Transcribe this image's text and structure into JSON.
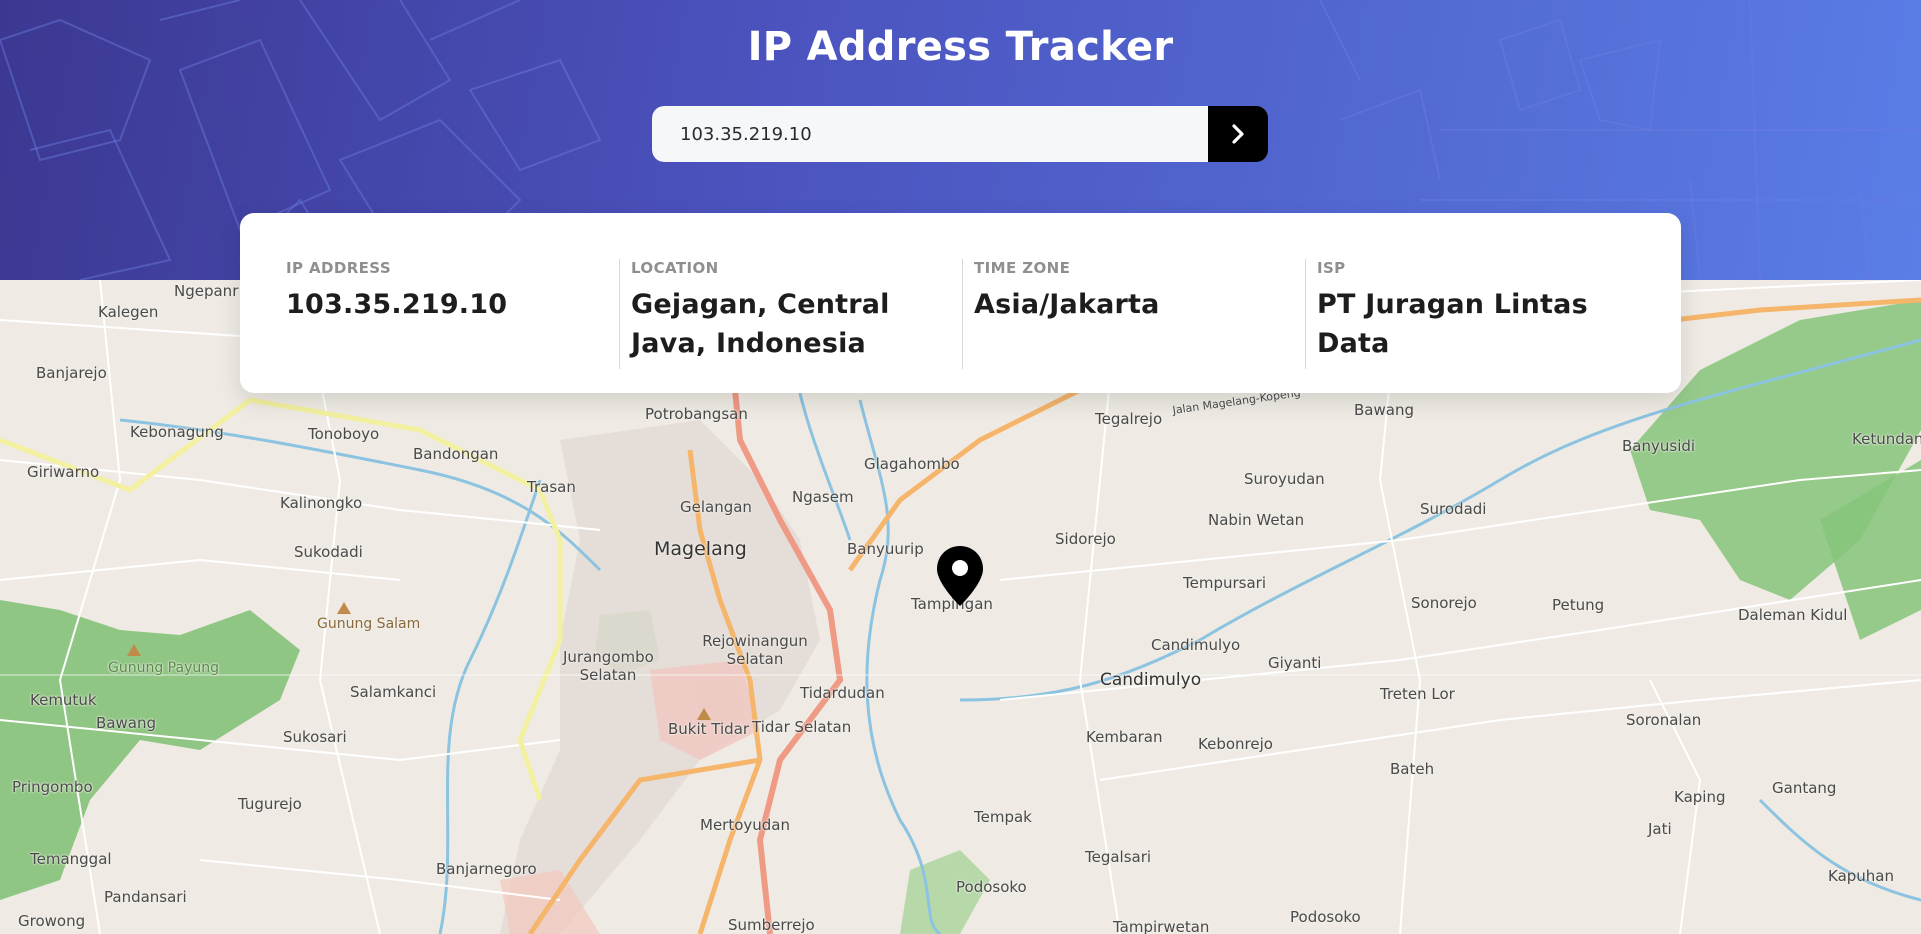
{
  "header": {
    "title": "IP Address Tracker",
    "search": {
      "value": "103.35.219.10",
      "submit_icon": "chevron-right-icon"
    }
  },
  "info": {
    "ip": {
      "label": "IP Address",
      "value": "103.35.219.10"
    },
    "location": {
      "label": "Location",
      "value": "Gejagan, Central Java, Indonesia"
    },
    "timezone": {
      "label": "Time Zone",
      "value": "Asia/Jakarta"
    },
    "isp": {
      "label": "ISP",
      "value": "PT Juragan Lintas Data"
    }
  },
  "map": {
    "marker_icon": "location-pin-icon",
    "labels": {
      "ngepanr": "Ngepanr",
      "kalegen": "Kalegen",
      "banjarejo": "Banjarejo",
      "kebonagung": "Kebonagung",
      "tonoboyo": "Tonoboyo",
      "bandongan": "Bandongan",
      "giriwarno": "Giriwarno",
      "kalinongko": "Kalinongko",
      "trasan": "Trasan",
      "sukodadi": "Sukodadi",
      "gunung_salam": "Gunung Salam",
      "gunung_payung": "Gunung Payung",
      "kemutuk": "Kemutuk",
      "salamkanci": "Salamkanci",
      "bawang_w": "Bawang",
      "sukosari": "Sukosari",
      "pringombo": "Pringombo",
      "tugurejo": "Tugurejo",
      "temanggal": "Temanggal",
      "pandansari": "Pandansari",
      "banjarnegoro": "Banjarnegoro",
      "growong": "Growong",
      "potrobangsan": "Potrobangsan",
      "gelangan": "Gelangan",
      "magelang": "Magelang",
      "ngasem": "Ngasem",
      "glagahombo": "Glagahombo",
      "banyuurip": "Banyuurip",
      "tampingan": "Tampingan",
      "jurangombo_selatan": "Jurangombo Selatan",
      "rejowinangun_selatan": "Rejowinangun Selatan",
      "tidardudan": "Tidardudan",
      "bukit_tidar": "Bukit Tidar",
      "tidar_selatan": "Tidar Selatan",
      "mertoyudan": "Mertoyudan",
      "tempak": "Tempak",
      "podosoko": "Podosoko",
      "sumberrejo": "Sumberrejo",
      "tegalrejo": "Tegalrejo",
      "jalan_magelang_kopeng": "Jalan Magelang-Kopeng",
      "bawang_e": "Bawang",
      "banyusidi": "Banyusidi",
      "ketundan": "Ketundan",
      "suroyudan": "Suroyudan",
      "surodadi": "Surodadi",
      "sidorejo": "Sidorejo",
      "nabin_wetan": "Nabin Wetan",
      "tempursari": "Tempursari",
      "sonorejo": "Sonorejo",
      "petung": "Petung",
      "daleman_kidul": "Daleman Kidul",
      "candimulyo_small": "Candimulyo",
      "candimulyo": "Candimulyo",
      "giyanti": "Giyanti",
      "treten_lor": "Treten Lor",
      "soronalan": "Soronalan",
      "kembaran": "Kembaran",
      "kebonrejo": "Kebonrejo",
      "bateh": "Bateh",
      "kaping": "Kaping",
      "gantang": "Gantang",
      "jati": "Jati",
      "kapuhan": "Kapuhan",
      "tegalsari": "Tegalsari",
      "podosoko_e": "Podosoko",
      "tampirwetan": "Tampirwetan"
    }
  }
}
